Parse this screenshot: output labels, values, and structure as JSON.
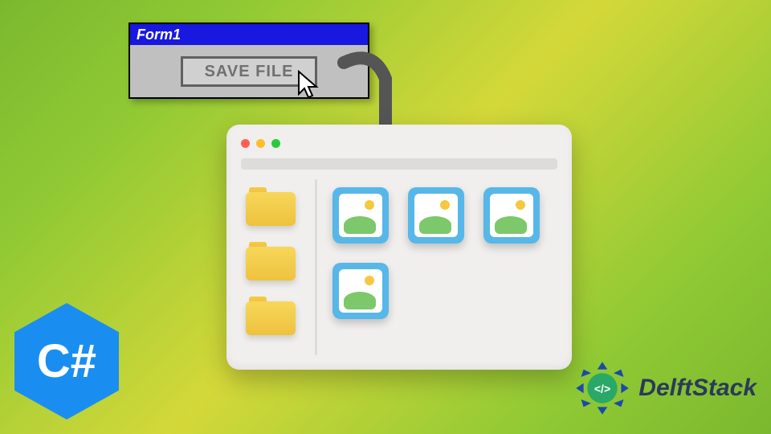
{
  "form": {
    "title": "Form1",
    "button_label": "SAVE FILE"
  },
  "csharp": {
    "label": "C#"
  },
  "delftstack": {
    "brand": "DelftStack",
    "badge_symbol": "</>"
  },
  "explorer": {
    "folder_count": 3,
    "image_count": 4
  },
  "colors": {
    "titlebar": "#1818e0",
    "csharp_hex": "#1a8ef0",
    "folder": "#f5c842",
    "tile": "#57b7e8"
  }
}
